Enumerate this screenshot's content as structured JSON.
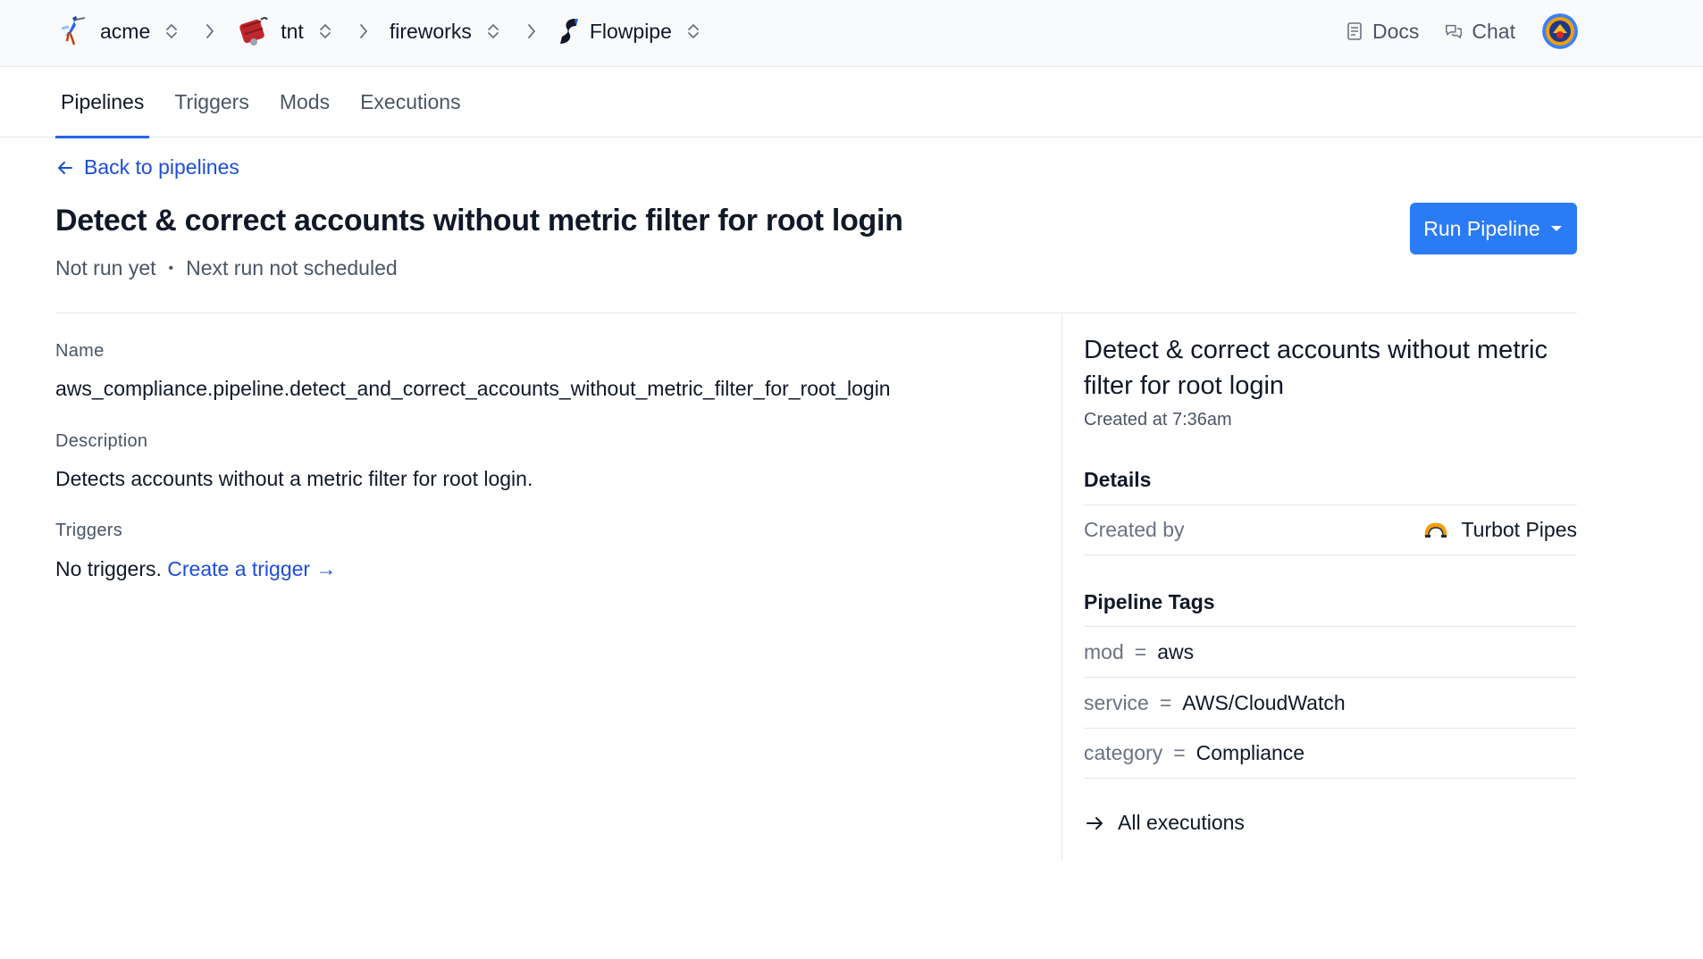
{
  "breadcrumb": [
    {
      "label": "acme",
      "icon": "roadrunner-icon"
    },
    {
      "label": "tnt",
      "icon": "dynamite-icon"
    },
    {
      "label": "fireworks",
      "icon": ""
    },
    {
      "label": "Flowpipe",
      "icon": "flowpipe-logo-icon"
    }
  ],
  "top_nav": {
    "docs_label": "Docs",
    "chat_label": "Chat"
  },
  "tabs": [
    {
      "label": "Pipelines",
      "active": true
    },
    {
      "label": "Triggers",
      "active": false
    },
    {
      "label": "Mods",
      "active": false
    },
    {
      "label": "Executions",
      "active": false
    }
  ],
  "back_link": "Back to pipelines",
  "pipeline": {
    "title": "Detect & correct accounts without metric filter for root login",
    "last_run": "Not run yet",
    "next_run": "Next run not scheduled",
    "run_button": "Run Pipeline",
    "name_label": "Name",
    "name": "aws_compliance.pipeline.detect_and_correct_accounts_without_metric_filter_for_root_login",
    "description_label": "Description",
    "description": "Detects accounts without a metric filter for root login.",
    "triggers_label": "Triggers",
    "triggers_empty": "No triggers.",
    "create_trigger": "Create a trigger →"
  },
  "panel": {
    "title": "Detect & correct accounts without metric filter for root login",
    "created_at": "Created at 7:36am",
    "details_heading": "Details",
    "created_by_label": "Created by",
    "created_by": "Turbot Pipes",
    "tags_heading": "Pipeline Tags",
    "tags": [
      {
        "key": "mod",
        "value": "aws"
      },
      {
        "key": "service",
        "value": "AWS/CloudWatch"
      },
      {
        "key": "category",
        "value": "Compliance"
      }
    ],
    "all_executions": "All executions"
  },
  "colors": {
    "accent": "#2b7bf7",
    "link": "#1d4ed8"
  }
}
